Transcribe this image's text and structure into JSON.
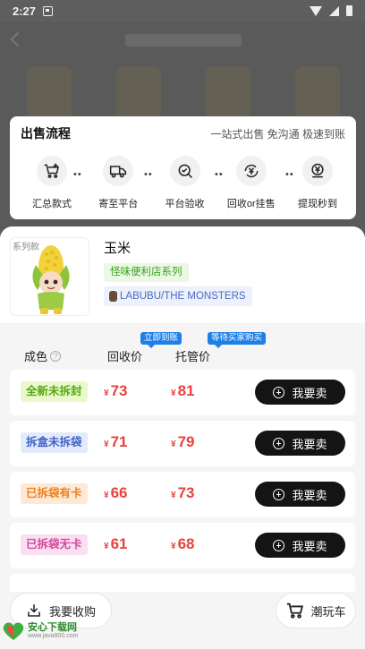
{
  "status_bar": {
    "time": "2:27"
  },
  "sell_flow": {
    "title": "出售流程",
    "subtitle": "一站式出售 免沟通 极速到账",
    "steps": [
      {
        "label": "汇总款式",
        "icon": "cart-plus-icon"
      },
      {
        "label": "寄至平台",
        "icon": "truck-icon"
      },
      {
        "label": "平台验收",
        "icon": "check-search-icon"
      },
      {
        "label": "回收or挂售",
        "icon": "yen-cycle-icon"
      },
      {
        "label": "提现秒到",
        "icon": "yen-withdraw-icon"
      }
    ],
    "connector": "••"
  },
  "product": {
    "thumb_tag": "系列款",
    "name": "玉米",
    "series": "怪味便利店系列",
    "ip": "LABUBU/THE MONSTERS"
  },
  "table": {
    "headers": {
      "condition": "成色",
      "help": "?",
      "recycle": "回收价",
      "consign": "托管价"
    },
    "badges": {
      "recycle": "立即到账",
      "consign": "等待买家购买"
    },
    "currency": "¥",
    "sell_label": "我要卖",
    "rows": [
      {
        "condition": "全新未拆封",
        "recycle": "73",
        "consign": "81",
        "tag_bg": "#e9f9cc",
        "tag_color": "#56a80f"
      },
      {
        "condition": "拆盒未拆袋",
        "recycle": "71",
        "consign": "79",
        "tag_bg": "#e3ebfb",
        "tag_color": "#3f63c7"
      },
      {
        "condition": "已拆袋有卡",
        "recycle": "66",
        "consign": "73",
        "tag_bg": "#fde9d6",
        "tag_color": "#f07f1f"
      },
      {
        "condition": "已拆袋无卡",
        "recycle": "61",
        "consign": "68",
        "tag_bg": "#f9e0f0",
        "tag_color": "#d2489e"
      }
    ]
  },
  "bottom_bar": {
    "want_buy": "我要收购",
    "cart": "潮玩车"
  },
  "watermark": {
    "name": "安心下载网",
    "url": "www.java800.com"
  }
}
